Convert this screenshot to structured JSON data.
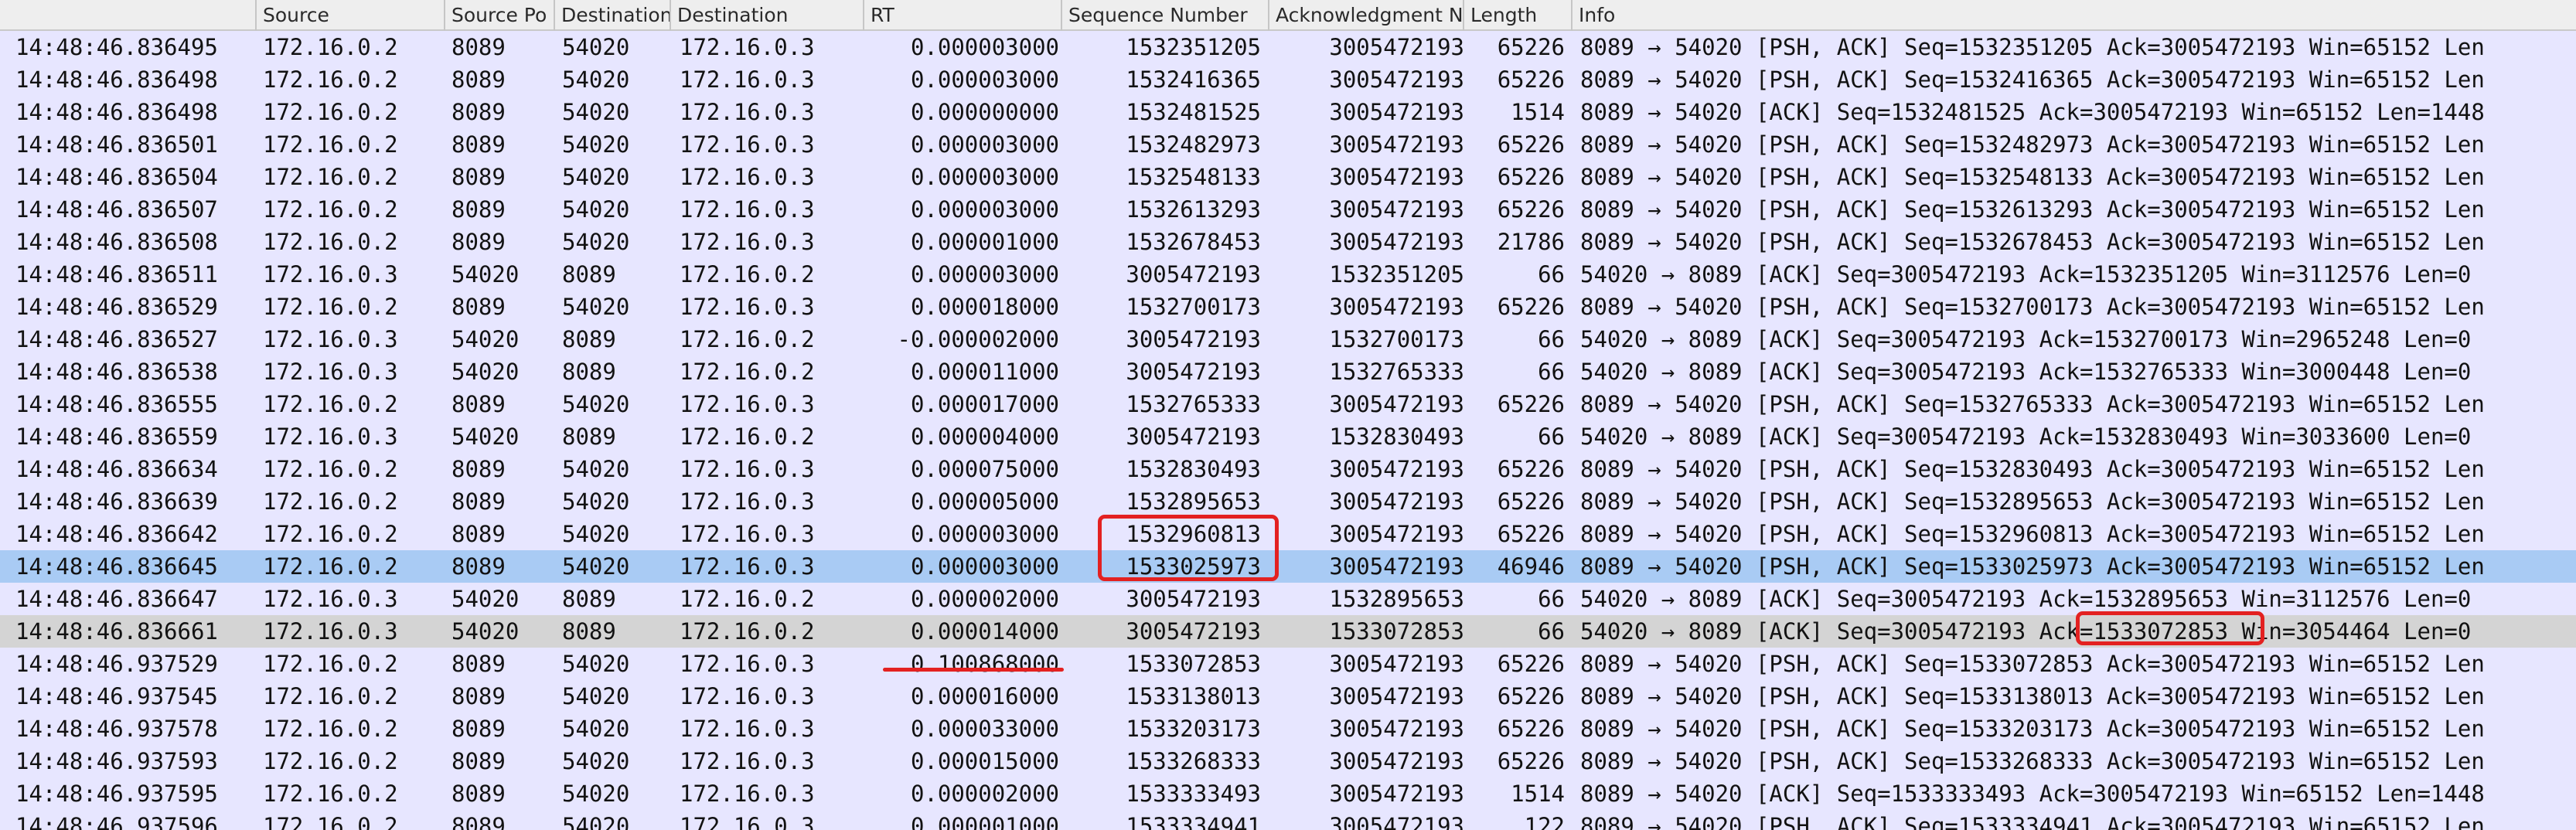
{
  "columns": [
    {
      "key": "time",
      "label": ""
    },
    {
      "key": "source",
      "label": "Source"
    },
    {
      "key": "source_port",
      "label": "Source Po"
    },
    {
      "key": "dest_port",
      "label": "Destination"
    },
    {
      "key": "destination",
      "label": "Destination"
    },
    {
      "key": "rt",
      "label": "RT"
    },
    {
      "key": "seq",
      "label": "Sequence Number"
    },
    {
      "key": "ack",
      "label": "Acknowledgment Nu"
    },
    {
      "key": "length",
      "label": "Length"
    },
    {
      "key": "info",
      "label": "Info"
    }
  ],
  "rows": [
    {
      "time": "14:48:46.836495",
      "source": "172.16.0.2",
      "source_port": "8089",
      "dest_port": "54020",
      "destination": "172.16.0.3",
      "rt": "0.000003000",
      "seq": "1532351205",
      "ack": "3005472193",
      "length": "65226",
      "info": "8089 → 54020 [PSH, ACK] Seq=1532351205 Ack=3005472193 Win=65152 Len"
    },
    {
      "time": "14:48:46.836498",
      "source": "172.16.0.2",
      "source_port": "8089",
      "dest_port": "54020",
      "destination": "172.16.0.3",
      "rt": "0.000003000",
      "seq": "1532416365",
      "ack": "3005472193",
      "length": "65226",
      "info": "8089 → 54020 [PSH, ACK] Seq=1532416365 Ack=3005472193 Win=65152 Len"
    },
    {
      "time": "14:48:46.836498",
      "source": "172.16.0.2",
      "source_port": "8089",
      "dest_port": "54020",
      "destination": "172.16.0.3",
      "rt": "0.000000000",
      "seq": "1532481525",
      "ack": "3005472193",
      "length": "1514",
      "info": "8089 → 54020 [ACK] Seq=1532481525 Ack=3005472193 Win=65152 Len=1448"
    },
    {
      "time": "14:48:46.836501",
      "source": "172.16.0.2",
      "source_port": "8089",
      "dest_port": "54020",
      "destination": "172.16.0.3",
      "rt": "0.000003000",
      "seq": "1532482973",
      "ack": "3005472193",
      "length": "65226",
      "info": "8089 → 54020 [PSH, ACK] Seq=1532482973 Ack=3005472193 Win=65152 Len"
    },
    {
      "time": "14:48:46.836504",
      "source": "172.16.0.2",
      "source_port": "8089",
      "dest_port": "54020",
      "destination": "172.16.0.3",
      "rt": "0.000003000",
      "seq": "1532548133",
      "ack": "3005472193",
      "length": "65226",
      "info": "8089 → 54020 [PSH, ACK] Seq=1532548133 Ack=3005472193 Win=65152 Len"
    },
    {
      "time": "14:48:46.836507",
      "source": "172.16.0.2",
      "source_port": "8089",
      "dest_port": "54020",
      "destination": "172.16.0.3",
      "rt": "0.000003000",
      "seq": "1532613293",
      "ack": "3005472193",
      "length": "65226",
      "info": "8089 → 54020 [PSH, ACK] Seq=1532613293 Ack=3005472193 Win=65152 Len"
    },
    {
      "time": "14:48:46.836508",
      "source": "172.16.0.2",
      "source_port": "8089",
      "dest_port": "54020",
      "destination": "172.16.0.3",
      "rt": "0.000001000",
      "seq": "1532678453",
      "ack": "3005472193",
      "length": "21786",
      "info": "8089 → 54020 [PSH, ACK] Seq=1532678453 Ack=3005472193 Win=65152 Len"
    },
    {
      "time": "14:48:46.836511",
      "source": "172.16.0.3",
      "source_port": "54020",
      "dest_port": "8089",
      "destination": "172.16.0.2",
      "rt": "0.000003000",
      "seq": "3005472193",
      "ack": "1532351205",
      "length": "66",
      "info": "54020 → 8089 [ACK] Seq=3005472193 Ack=1532351205 Win=3112576 Len=0"
    },
    {
      "time": "14:48:46.836529",
      "source": "172.16.0.2",
      "source_port": "8089",
      "dest_port": "54020",
      "destination": "172.16.0.3",
      "rt": "0.000018000",
      "seq": "1532700173",
      "ack": "3005472193",
      "length": "65226",
      "info": "8089 → 54020 [PSH, ACK] Seq=1532700173 Ack=3005472193 Win=65152 Len"
    },
    {
      "time": "14:48:46.836527",
      "source": "172.16.0.3",
      "source_port": "54020",
      "dest_port": "8089",
      "destination": "172.16.0.2",
      "rt": "-0.000002000",
      "seq": "3005472193",
      "ack": "1532700173",
      "length": "66",
      "info": "54020 → 8089 [ACK] Seq=3005472193 Ack=1532700173 Win=2965248 Len=0"
    },
    {
      "time": "14:48:46.836538",
      "source": "172.16.0.3",
      "source_port": "54020",
      "dest_port": "8089",
      "destination": "172.16.0.2",
      "rt": "0.000011000",
      "seq": "3005472193",
      "ack": "1532765333",
      "length": "66",
      "info": "54020 → 8089 [ACK] Seq=3005472193 Ack=1532765333 Win=3000448 Len=0"
    },
    {
      "time": "14:48:46.836555",
      "source": "172.16.0.2",
      "source_port": "8089",
      "dest_port": "54020",
      "destination": "172.16.0.3",
      "rt": "0.000017000",
      "seq": "1532765333",
      "ack": "3005472193",
      "length": "65226",
      "info": "8089 → 54020 [PSH, ACK] Seq=1532765333 Ack=3005472193 Win=65152 Len"
    },
    {
      "time": "14:48:46.836559",
      "source": "172.16.0.3",
      "source_port": "54020",
      "dest_port": "8089",
      "destination": "172.16.0.2",
      "rt": "0.000004000",
      "seq": "3005472193",
      "ack": "1532830493",
      "length": "66",
      "info": "54020 → 8089 [ACK] Seq=3005472193 Ack=1532830493 Win=3033600 Len=0"
    },
    {
      "time": "14:48:46.836634",
      "source": "172.16.0.2",
      "source_port": "8089",
      "dest_port": "54020",
      "destination": "172.16.0.3",
      "rt": "0.000075000",
      "seq": "1532830493",
      "ack": "3005472193",
      "length": "65226",
      "info": "8089 → 54020 [PSH, ACK] Seq=1532830493 Ack=3005472193 Win=65152 Len"
    },
    {
      "time": "14:48:46.836639",
      "source": "172.16.0.2",
      "source_port": "8089",
      "dest_port": "54020",
      "destination": "172.16.0.3",
      "rt": "0.000005000",
      "seq": "1532895653",
      "ack": "3005472193",
      "length": "65226",
      "info": "8089 → 54020 [PSH, ACK] Seq=1532895653 Ack=3005472193 Win=65152 Len"
    },
    {
      "time": "14:48:46.836642",
      "source": "172.16.0.2",
      "source_port": "8089",
      "dest_port": "54020",
      "destination": "172.16.0.3",
      "rt": "0.000003000",
      "seq": "1532960813",
      "ack": "3005472193",
      "length": "65226",
      "info": "8089 → 54020 [PSH, ACK] Seq=1532960813 Ack=3005472193 Win=65152 Len"
    },
    {
      "time": "14:48:46.836645",
      "source": "172.16.0.2",
      "source_port": "8089",
      "dest_port": "54020",
      "destination": "172.16.0.3",
      "rt": "0.000003000",
      "seq": "1533025973",
      "ack": "3005472193",
      "length": "46946",
      "info": "8089 → 54020 [PSH, ACK] Seq=1533025973 Ack=3005472193 Win=65152 Len",
      "state": "selected"
    },
    {
      "time": "14:48:46.836647",
      "source": "172.16.0.3",
      "source_port": "54020",
      "dest_port": "8089",
      "destination": "172.16.0.2",
      "rt": "0.000002000",
      "seq": "3005472193",
      "ack": "1532895653",
      "length": "66",
      "info": "54020 → 8089 [ACK] Seq=3005472193 Ack=1532895653 Win=3112576 Len=0"
    },
    {
      "time": "14:48:46.836661",
      "source": "172.16.0.3",
      "source_port": "54020",
      "dest_port": "8089",
      "destination": "172.16.0.2",
      "rt": "0.000014000",
      "seq": "3005472193",
      "ack": "1533072853",
      "length": "66",
      "info": "54020 → 8089 [ACK] Seq=3005472193 Ack=1533072853 Win=3054464 Len=0",
      "state": "marked-grey"
    },
    {
      "time": "14:48:46.937529",
      "source": "172.16.0.2",
      "source_port": "8089",
      "dest_port": "54020",
      "destination": "172.16.0.3",
      "rt": "0.100868000",
      "seq": "1533072853",
      "ack": "3005472193",
      "length": "65226",
      "info": "8089 → 54020 [PSH, ACK] Seq=1533072853 Ack=3005472193 Win=65152 Len"
    },
    {
      "time": "14:48:46.937545",
      "source": "172.16.0.2",
      "source_port": "8089",
      "dest_port": "54020",
      "destination": "172.16.0.3",
      "rt": "0.000016000",
      "seq": "1533138013",
      "ack": "3005472193",
      "length": "65226",
      "info": "8089 → 54020 [PSH, ACK] Seq=1533138013 Ack=3005472193 Win=65152 Len"
    },
    {
      "time": "14:48:46.937578",
      "source": "172.16.0.2",
      "source_port": "8089",
      "dest_port": "54020",
      "destination": "172.16.0.3",
      "rt": "0.000033000",
      "seq": "1533203173",
      "ack": "3005472193",
      "length": "65226",
      "info": "8089 → 54020 [PSH, ACK] Seq=1533203173 Ack=3005472193 Win=65152 Len"
    },
    {
      "time": "14:48:46.937593",
      "source": "172.16.0.2",
      "source_port": "8089",
      "dest_port": "54020",
      "destination": "172.16.0.3",
      "rt": "0.000015000",
      "seq": "1533268333",
      "ack": "3005472193",
      "length": "65226",
      "info": "8089 → 54020 [PSH, ACK] Seq=1533268333 Ack=3005472193 Win=65152 Len"
    },
    {
      "time": "14:48:46.937595",
      "source": "172.16.0.2",
      "source_port": "8089",
      "dest_port": "54020",
      "destination": "172.16.0.3",
      "rt": "0.000002000",
      "seq": "1533333493",
      "ack": "3005472193",
      "length": "1514",
      "info": "8089 → 54020 [ACK] Seq=1533333493 Ack=3005472193 Win=65152 Len=1448"
    },
    {
      "time": "14:48:46.937596",
      "source": "172.16.0.2",
      "source_port": "8089",
      "dest_port": "54020",
      "destination": "172.16.0.3",
      "rt": "0.000001000",
      "seq": "1533334941",
      "ack": "3005472193",
      "length": "122",
      "info": "8089 → 54020 [PSH, ACK] Seq=1533334941 Ack=3005472193 Win=65152 Len"
    }
  ],
  "annotation_color": "#e32121",
  "selected_row_color": "#a9cbf4",
  "grey_row_color": "#d4d4d4",
  "row_background_color": "#e7e6ff"
}
